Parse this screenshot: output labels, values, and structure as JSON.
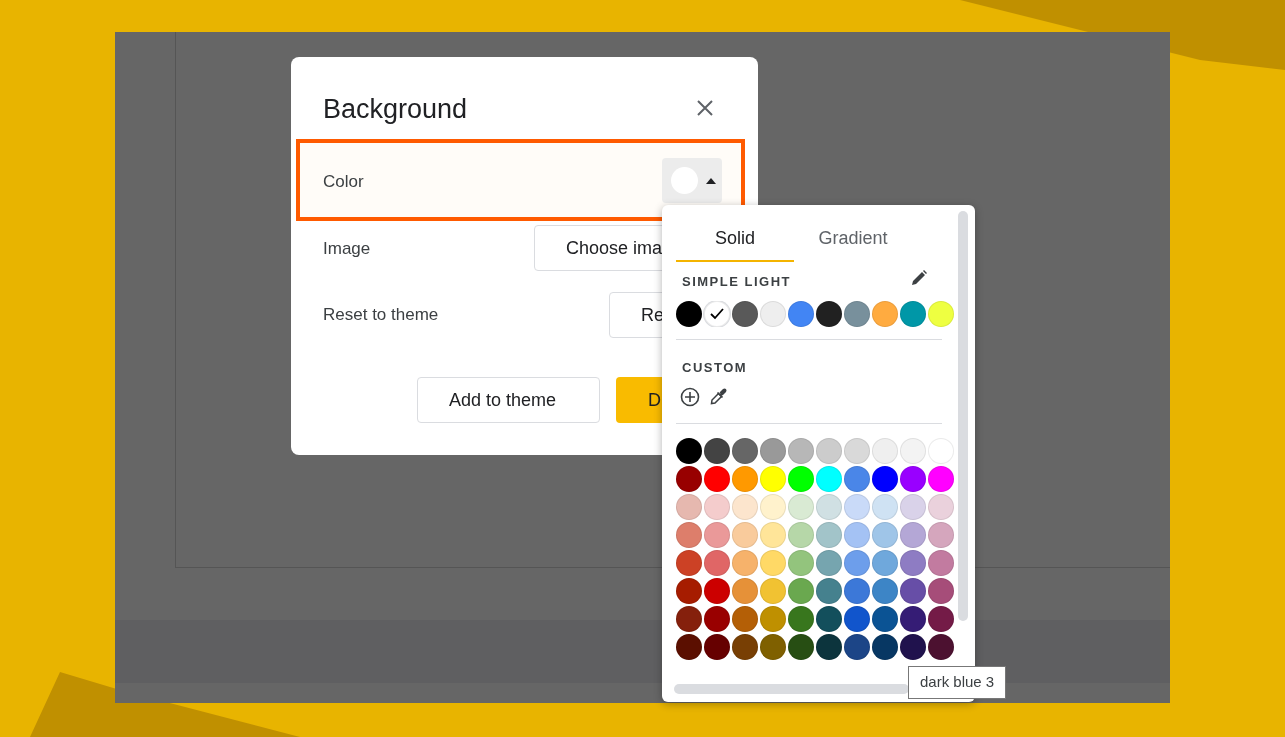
{
  "dialog": {
    "title": "Background",
    "color_label": "Color",
    "image_label": "Image",
    "image_button": "Choose ima",
    "reset_label": "Reset to theme",
    "reset_button": "Re",
    "buttons": [
      {
        "label": "Add to theme",
        "primary": false
      },
      {
        "label": "D",
        "primary": true
      }
    ]
  },
  "color_picker": {
    "tabs": [
      {
        "label": "Solid",
        "selected": true
      },
      {
        "label": "Gradient",
        "selected": false
      }
    ],
    "theme": {
      "title": "SIMPLE LIGHT",
      "swatches": [
        {
          "color": "#000000",
          "selected": false
        },
        {
          "color": "#ffffff",
          "selected": true
        },
        {
          "color": "#595959",
          "selected": false
        },
        {
          "color": "#eeeeee",
          "selected": false
        },
        {
          "color": "#4285f4",
          "selected": false
        },
        {
          "color": "#212121",
          "selected": false
        },
        {
          "color": "#78909c",
          "selected": false
        },
        {
          "color": "#ffab40",
          "selected": false
        },
        {
          "color": "#0097a7",
          "selected": false
        },
        {
          "color": "#eeff41",
          "selected": false
        }
      ]
    },
    "custom": {
      "title": "CUSTOM"
    },
    "palette": [
      {
        "swatches": [
          {
            "color": "#000000"
          },
          {
            "color": "#434343"
          },
          {
            "color": "#666666"
          },
          {
            "color": "#999999"
          },
          {
            "color": "#b7b7b7"
          },
          {
            "color": "#cccccc"
          },
          {
            "color": "#d9d9d9"
          },
          {
            "color": "#efefef"
          },
          {
            "color": "#f3f3f3"
          },
          {
            "color": "#ffffff"
          }
        ]
      },
      {
        "swatches": [
          {
            "color": "#980000"
          },
          {
            "color": "#ff0000"
          },
          {
            "color": "#ff9900"
          },
          {
            "color": "#ffff00"
          },
          {
            "color": "#00ff00"
          },
          {
            "color": "#00ffff"
          },
          {
            "color": "#4a86e8"
          },
          {
            "color": "#0000ff"
          },
          {
            "color": "#9900ff"
          },
          {
            "color": "#ff00ff"
          }
        ]
      },
      {
        "swatches": [
          {
            "color": "#e6b8af"
          },
          {
            "color": "#f4cccc"
          },
          {
            "color": "#fce5cd"
          },
          {
            "color": "#fff2cc"
          },
          {
            "color": "#d9ead3"
          },
          {
            "color": "#d0e0e3"
          },
          {
            "color": "#c9daf8"
          },
          {
            "color": "#cfe2f3"
          },
          {
            "color": "#d9d2e9"
          },
          {
            "color": "#ead1dc"
          }
        ]
      },
      {
        "swatches": [
          {
            "color": "#dd7e6b"
          },
          {
            "color": "#ea9999"
          },
          {
            "color": "#f9cb9c"
          },
          {
            "color": "#ffe599"
          },
          {
            "color": "#b6d7a8"
          },
          {
            "color": "#a2c4c9"
          },
          {
            "color": "#a4c2f4"
          },
          {
            "color": "#9fc5e8"
          },
          {
            "color": "#b4a7d6"
          },
          {
            "color": "#d5a6bd"
          }
        ]
      },
      {
        "swatches": [
          {
            "color": "#cc4125"
          },
          {
            "color": "#e06666"
          },
          {
            "color": "#f6b26b"
          },
          {
            "color": "#ffd966"
          },
          {
            "color": "#93c47d"
          },
          {
            "color": "#76a5af"
          },
          {
            "color": "#6d9eeb"
          },
          {
            "color": "#6fa8dc"
          },
          {
            "color": "#8e7cc3"
          },
          {
            "color": "#c27ba0"
          }
        ]
      },
      {
        "swatches": [
          {
            "color": "#a61c00"
          },
          {
            "color": "#cc0000"
          },
          {
            "color": "#e69138"
          },
          {
            "color": "#f1c232"
          },
          {
            "color": "#6aa84f"
          },
          {
            "color": "#45818e"
          },
          {
            "color": "#3c78d8"
          },
          {
            "color": "#3d85c6"
          },
          {
            "color": "#674ea7"
          },
          {
            "color": "#a64d79"
          }
        ]
      },
      {
        "swatches": [
          {
            "color": "#85200c"
          },
          {
            "color": "#990000"
          },
          {
            "color": "#b45f06"
          },
          {
            "color": "#bf9000"
          },
          {
            "color": "#38761d"
          },
          {
            "color": "#134f5c"
          },
          {
            "color": "#1155cc"
          },
          {
            "color": "#0b5394"
          },
          {
            "color": "#351c75"
          },
          {
            "color": "#741b47"
          }
        ]
      },
      {
        "swatches": [
          {
            "color": "#5b0f00"
          },
          {
            "color": "#660000"
          },
          {
            "color": "#783f04"
          },
          {
            "color": "#7f6000"
          },
          {
            "color": "#274e13"
          },
          {
            "color": "#0c343d"
          },
          {
            "color": "#1c4587"
          },
          {
            "color": "#073763"
          },
          {
            "color": "#20124d"
          },
          {
            "color": "#4c1130"
          }
        ]
      }
    ],
    "tooltip": "dark blue 3"
  }
}
